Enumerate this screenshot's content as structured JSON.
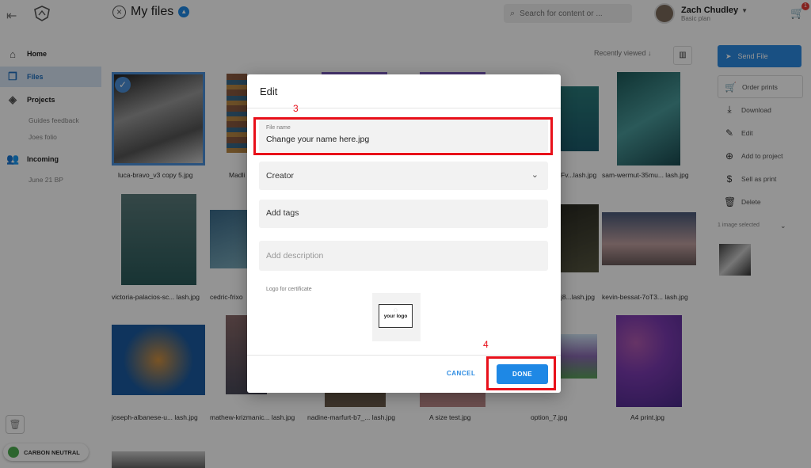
{
  "header": {
    "title": "My files",
    "search_placeholder": "Search for content or ...",
    "user_name": "Zach Chudley",
    "user_plan": "Basic plan",
    "cart_count": "1"
  },
  "sidebar": {
    "items": [
      {
        "label": "Home",
        "icon": "home-icon"
      },
      {
        "label": "Files",
        "icon": "files-icon"
      },
      {
        "label": "Projects",
        "icon": "layers-icon"
      },
      {
        "label": "Incoming",
        "icon": "people-icon"
      }
    ],
    "project_subitems": [
      "Guides feedback",
      "Joes folio"
    ],
    "incoming_subitems": [
      "June 21 BP"
    ],
    "carbon_label": "CARBON NEUTRAL"
  },
  "toolbar": {
    "sort_label": "Recently viewed"
  },
  "files": [
    {
      "name": "luca-bravo_v3 copy 5.jpg",
      "selected": true
    },
    {
      "name": "Madli"
    },
    {
      "name": "Fv...lash.jpg"
    },
    {
      "name": "sam-wermut-35mu... lash.jpg"
    },
    {
      "name": "victoria-palacios-sc... lash.jpg"
    },
    {
      "name": "cedric-frixo"
    },
    {
      "name": "j8...lash.jpg"
    },
    {
      "name": "kevin-bessat-7oT3... lash.jpg"
    },
    {
      "name": "joseph-albanese-u... lash.jpg"
    },
    {
      "name": "mathew-krizmanic... lash.jpg"
    },
    {
      "name": "nadine-marfurt-b7_... lash.jpg"
    },
    {
      "name": "A size test.jpg"
    },
    {
      "name": "option_7.jpg"
    },
    {
      "name": "A4 print.jpg"
    }
  ],
  "right_panel": {
    "send_label": "Send File",
    "actions": [
      "Order prints",
      "Download",
      "Edit",
      "Add to project",
      "Sell as print",
      "Delete"
    ],
    "selected_text": "1 image selected"
  },
  "modal": {
    "title": "Edit",
    "file_name_label": "File name",
    "file_name_value": "Change your name here.jpg",
    "creator_label": "Creator",
    "tags_placeholder": "Add tags",
    "description_placeholder": "Add description",
    "logo_label": "Logo for certificate",
    "logo_text": "your logo",
    "cancel_label": "CANCEL",
    "done_label": "DONE"
  },
  "annotations": {
    "step_3": "3",
    "step_4": "4",
    "color": "#e8101a"
  }
}
